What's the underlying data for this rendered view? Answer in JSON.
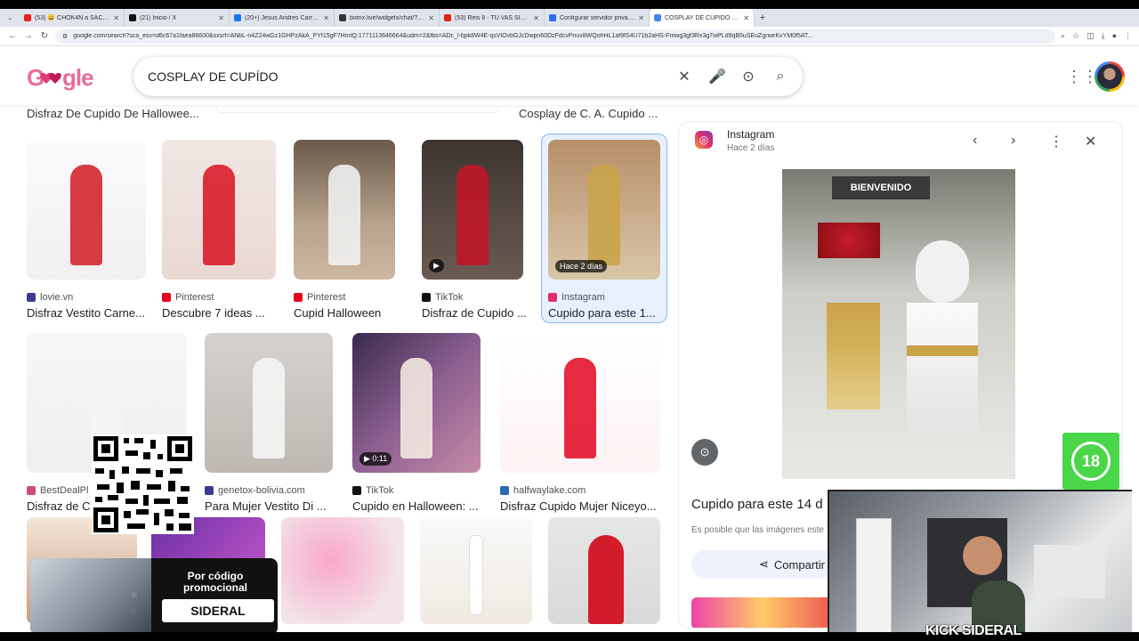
{
  "browser": {
    "tabs": [
      {
        "title": "(53) 😄 CHOK4N a SACHA...",
        "color": "#e62117"
      },
      {
        "title": "(21) Inicio / X",
        "color": "#111111"
      },
      {
        "title": "(20+) Jesus Andres Carrion | Fa...",
        "color": "#1877f2"
      },
      {
        "title": "botrix.live/widgets/chat/?bid=...",
        "color": "#333333"
      },
      {
        "title": "(53) Reis 8 - TU VAS SIN (fav) ...",
        "color": "#e62117"
      },
      {
        "title": "Configurar servidor privado - K...",
        "color": "#2a6df4"
      },
      {
        "title": "COSPLAY DE CUPÍDO - Buscar ...",
        "color": "#4285f4",
        "active": true
      }
    ],
    "url": "google.com/search?sca_esv=d6c67a1faea86600&sxsrf=ANbL-n4Z24wGz1GHPzAkA_PYf15gF7HmtQ:1771113646664&udm=2&fbs=ADc_l-bpk8W4E-qsVlOvbGJcDwpn60DzFdcvPnuv8WQohHL1af9fS4U71b2aHS-Fmwg3gf3Rx3g7wPLd9qB5uSEuZgnwrKvYM0f5AT..."
  },
  "search": {
    "logo": "Google",
    "query": "COSPLAY DE CUPÍDO"
  },
  "prev_captions": [
    "Disfraz De Cupido De Hallowee...",
    "Cosplay de C. A. Cupido ..."
  ],
  "results": [
    {
      "source": "lovie.vn",
      "caption": "Disfraz Vestito Carne...",
      "si": "#3b3b8f",
      "badge": ""
    },
    {
      "source": "Pinterest",
      "caption": "Descubre 7 ideas ...",
      "si": "#e60023",
      "badge": ""
    },
    {
      "source": "Pinterest",
      "caption": "Cupid Halloween",
      "si": "#e60023",
      "badge": ""
    },
    {
      "source": "TikTok",
      "caption": "Disfraz de Cupido ...",
      "si": "#111111",
      "badge": "▶"
    },
    {
      "source": "Instagram",
      "caption": "Cupido para este 1...",
      "si": "#e1306c",
      "badge": "Hace 2 días"
    },
    {
      "source": "BestDealPl",
      "caption": "Disfraz de C",
      "si": "#d04a7a",
      "badge": ""
    },
    {
      "source": "genetox-bolivia.com",
      "caption": "Para Mujer Vestito Di ...",
      "si": "#3b3b8f",
      "badge": ""
    },
    {
      "source": "TikTok",
      "caption": "Cupido en Halloween: ...",
      "si": "#111111",
      "badge": "▶ 0:11"
    },
    {
      "source": "halfwaylake.com",
      "caption": "Disfraz Cupido Mujer Niceyo...",
      "si": "#2b6cb0",
      "badge": ""
    }
  ],
  "panel": {
    "source": "Instagram",
    "time": "Hace 2 días",
    "image_sign": "BIENVENIDO",
    "title": "Cupido para este 14 d",
    "note": "Es posible que las imágenes este",
    "share_label": "Compartir"
  },
  "overlays": {
    "promo_text": "Por código promocional",
    "promo_code": "SIDERAL",
    "age_badge": "18",
    "stream_brand": "KICK SIDERAL"
  }
}
